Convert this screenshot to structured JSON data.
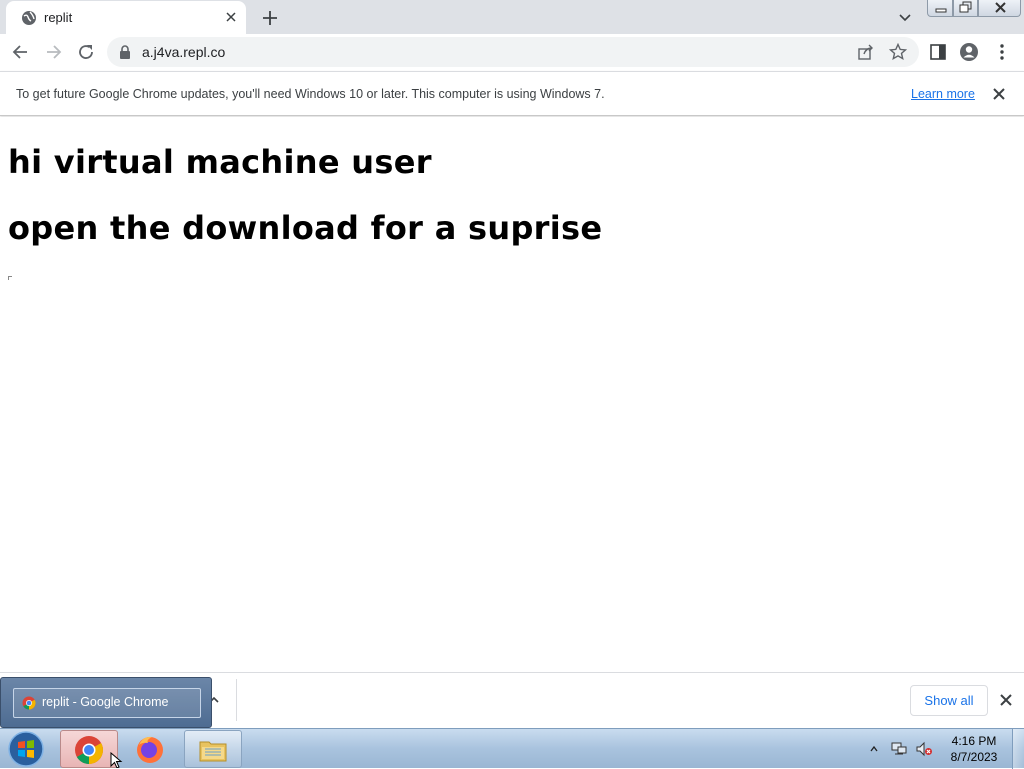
{
  "browser": {
    "tab": {
      "title": "replit",
      "favicon": "globe-icon"
    },
    "new_tab_label": "+",
    "address": {
      "url": "a.j4va.repl.co"
    },
    "infobar": {
      "message": "To get future Google Chrome updates, you'll need Windows 10 or later. This computer is using Windows 7.",
      "link": "Learn more"
    }
  },
  "page": {
    "line1": "hi virtual machine user",
    "line2": "open the download for a suprise"
  },
  "download_shelf": {
    "show_all": "Show all"
  },
  "taskbar": {
    "thumbnail_label": "replit - Google Chrome",
    "clock_time": "4:16 PM",
    "clock_date": "8/7/2023",
    "apps": [
      "chrome-icon",
      "firefox-icon",
      "file-explorer-icon"
    ]
  },
  "colors": {
    "accent": "#1a73e8",
    "tabstrip": "#dee1e6",
    "omnibox": "#f1f3f4"
  }
}
